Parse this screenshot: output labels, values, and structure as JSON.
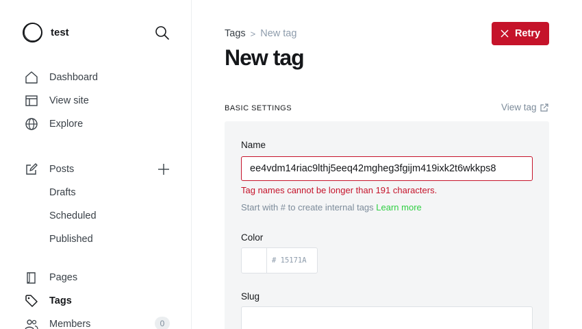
{
  "site": {
    "name": "test"
  },
  "nav": {
    "dashboard": "Dashboard",
    "view_site": "View site",
    "explore": "Explore",
    "posts": "Posts",
    "drafts": "Drafts",
    "scheduled": "Scheduled",
    "published": "Published",
    "pages": "Pages",
    "tags": "Tags",
    "members": "Members",
    "members_count": "0"
  },
  "breadcrumb": {
    "parent": "Tags",
    "separator": ">",
    "current": "New tag"
  },
  "page": {
    "title": "New tag"
  },
  "retry": {
    "label": "Retry"
  },
  "section": {
    "label": "BASIC SETTINGS",
    "view_tag": "View tag"
  },
  "form": {
    "name_label": "Name",
    "name_value": "ee4vdm14riac9lthj5eeq42mgheg3fgijm419ixk2t6wkkps8",
    "name_error": "Tag names cannot be longer than 191 characters.",
    "name_hint": "Start with # to create internal tags ",
    "learn_more": "Learn more",
    "color_label": "Color",
    "color_value": "# 15171A",
    "slug_label": "Slug",
    "slug_value": ""
  },
  "colors": {
    "accent": "#c5132a",
    "link": "#30cf43",
    "panel": "#f4f5f6"
  }
}
